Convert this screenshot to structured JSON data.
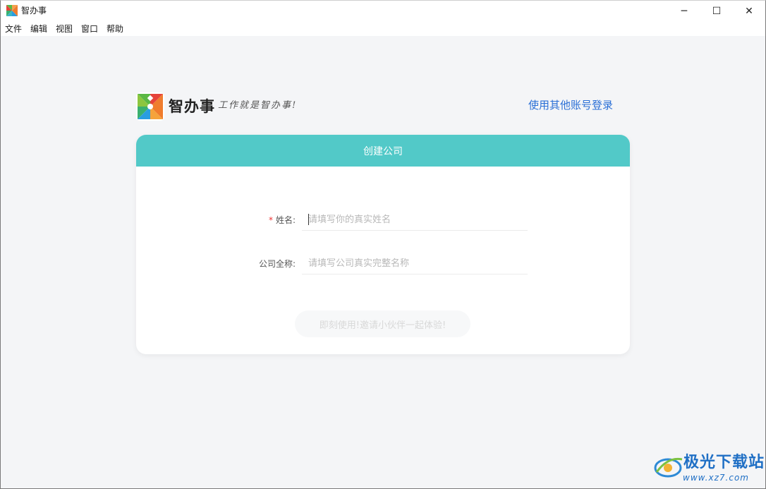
{
  "window": {
    "title": "智办事",
    "controls": {
      "minimize": "─",
      "maximize": "☐",
      "close": "✕"
    }
  },
  "menu": [
    "文件",
    "编辑",
    "视图",
    "窗口",
    "帮助"
  ],
  "brand": {
    "name": "智办事",
    "slogan": "工作就是智办事!",
    "logo_icon": "pinwheel-logo-icon",
    "logo_colors": [
      "#5bb845",
      "#ef7d2f",
      "#2a9de0",
      "#e6433a"
    ]
  },
  "other_login_link": "使用其他账号登录",
  "card": {
    "title": "创建公司",
    "header_color": "#52c9c8",
    "fields": {
      "name": {
        "label": "姓名:",
        "required_mark": "*",
        "value": "",
        "placeholder": "请填写你的真实姓名"
      },
      "company": {
        "label": "公司全称:",
        "value": "",
        "placeholder": "请填写公司真实完整名称"
      }
    },
    "submit_label": "即刻使用!邀请小伙伴一起体验!"
  },
  "watermark": {
    "text": "极光下载站",
    "url": "www.xz7.com"
  },
  "colors": {
    "accent": "#52c9c8",
    "link": "#2a6fd6",
    "required": "#e33333"
  }
}
